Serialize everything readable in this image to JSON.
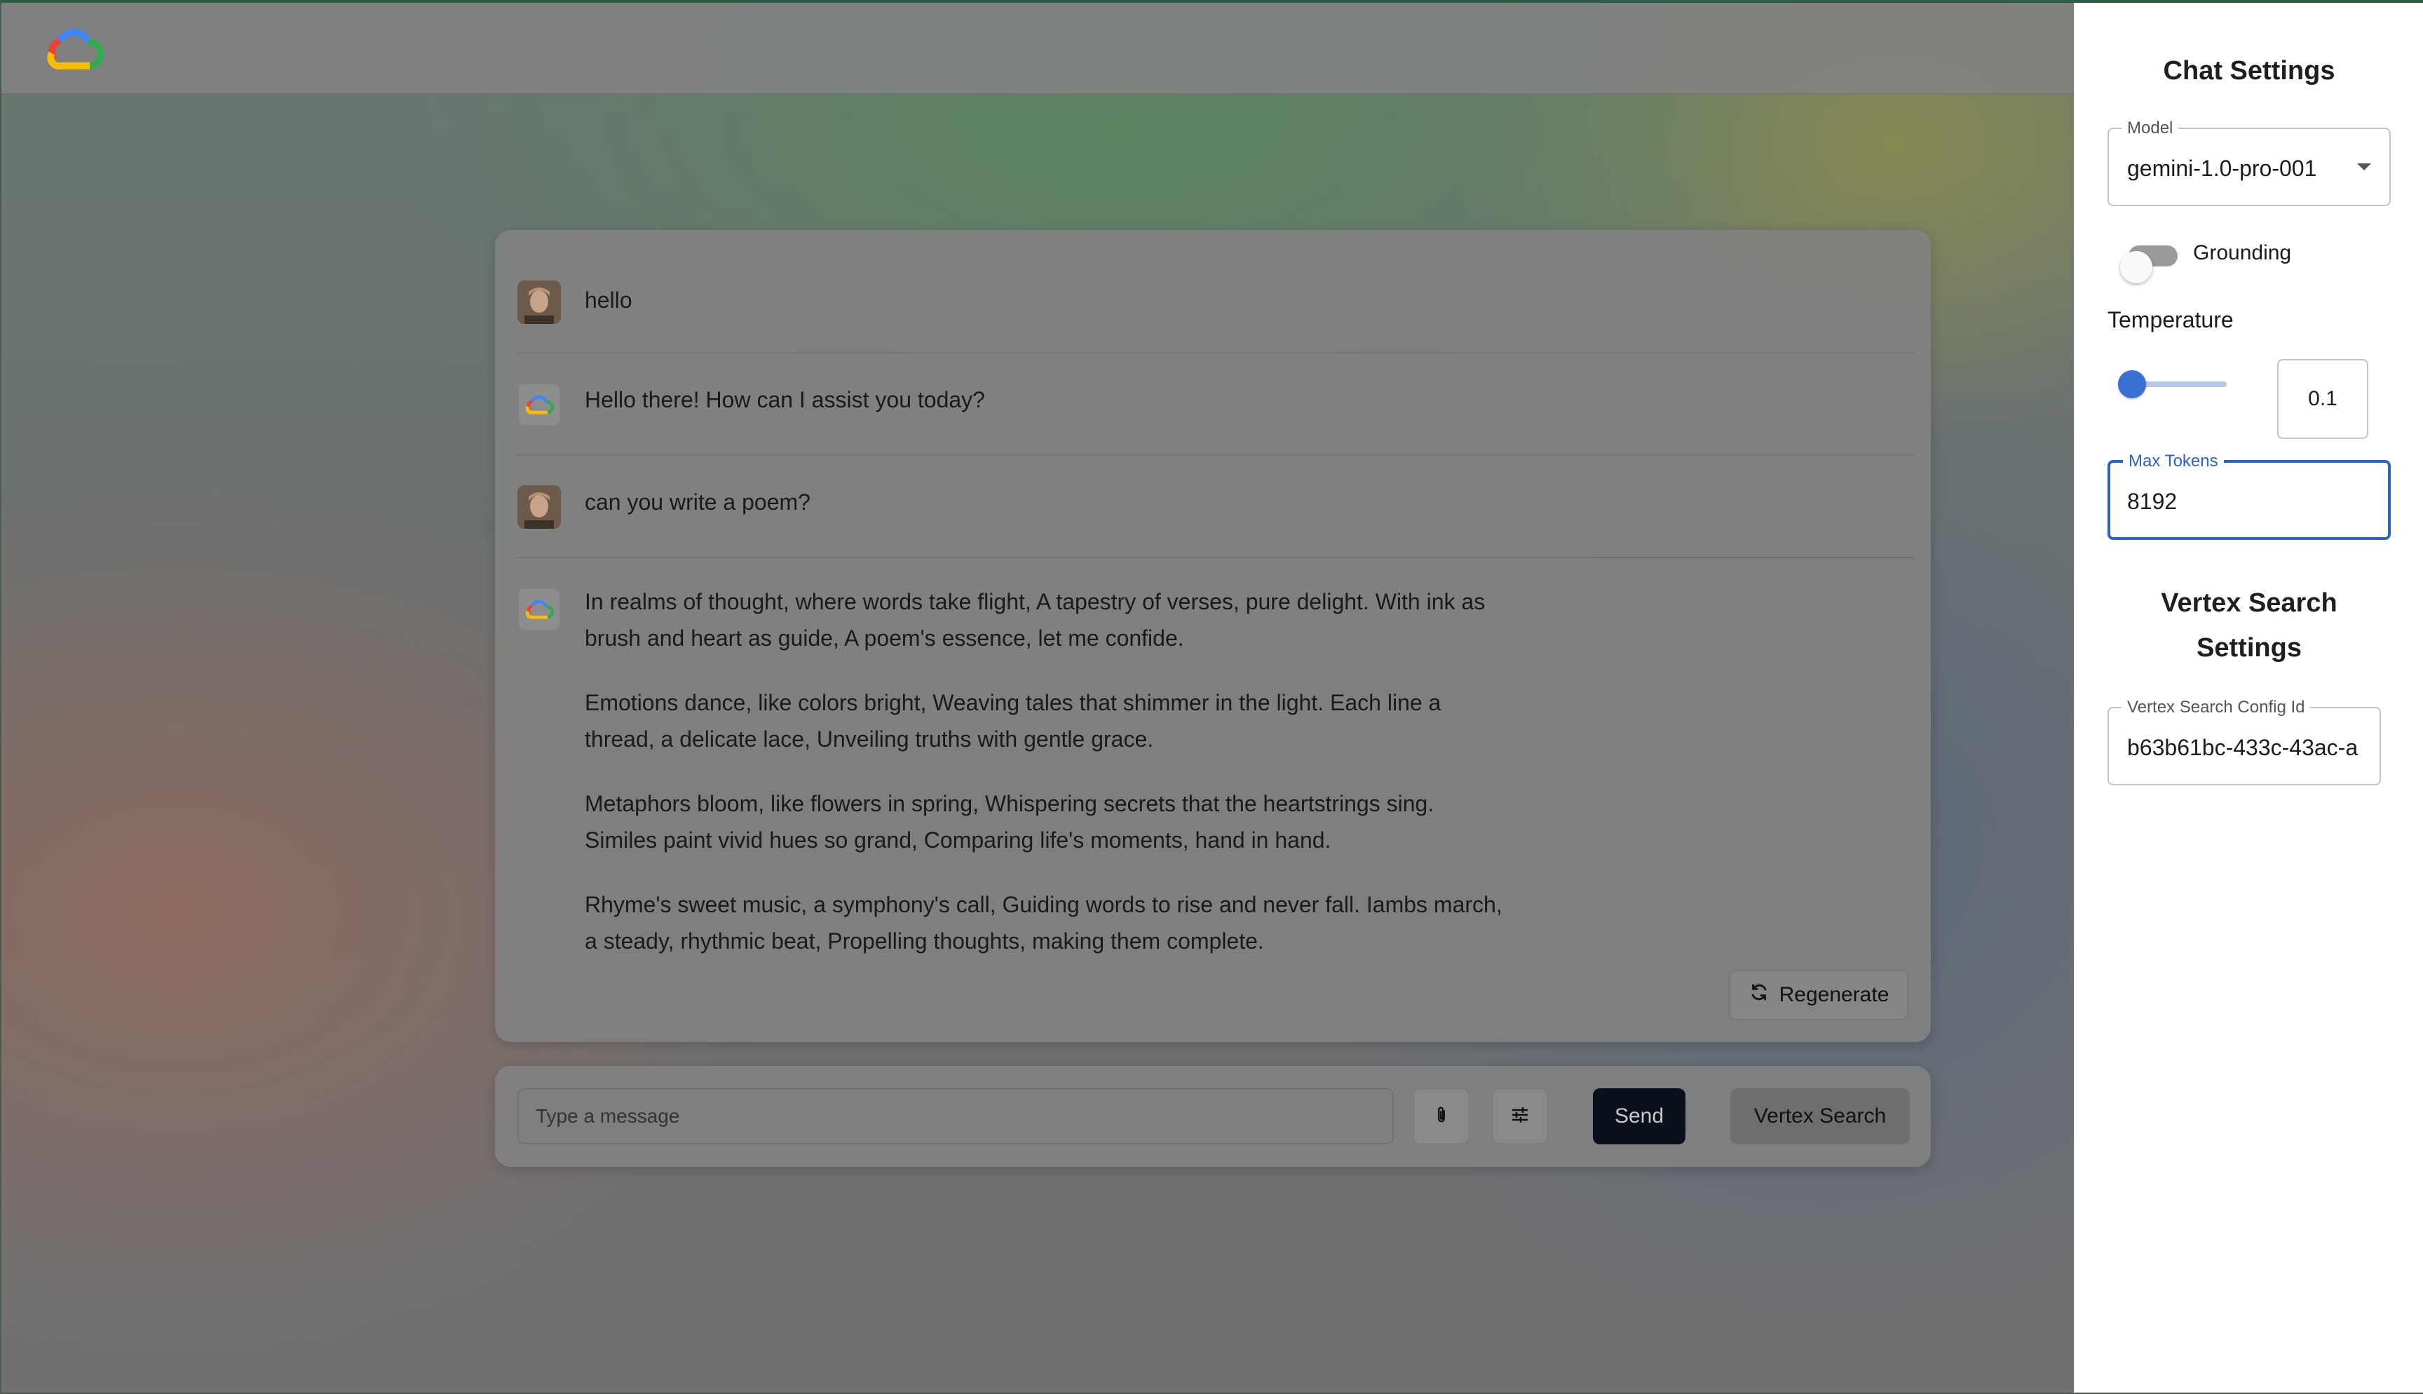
{
  "chat": {
    "messages": [
      {
        "role": "user",
        "text": "hello"
      },
      {
        "role": "assistant",
        "text": "Hello there! How can I assist you today?"
      },
      {
        "role": "user",
        "text": "can you write a poem?"
      },
      {
        "role": "assistant",
        "paragraphs": [
          "In realms of thought, where words take flight, A tapestry of verses, pure delight. With ink as brush and heart as guide, A poem's essence, let me confide.",
          "Emotions dance, like colors bright, Weaving tales that shimmer in the light. Each line a thread, a delicate lace, Unveiling truths with gentle grace.",
          "Metaphors bloom, like flowers in spring, Whispering secrets that the heartstrings sing. Similes paint vivid hues so grand, Comparing life's moments, hand in hand.",
          "Rhyme's sweet music, a symphony's call, Guiding words to rise and never fall. Iambs march, a steady, rhythmic beat, Propelling thoughts, making them complete."
        ]
      }
    ],
    "regenerate_label": "Regenerate"
  },
  "input": {
    "placeholder": "Type a message",
    "send_label": "Send",
    "vertex_search_label": "Vertex Search",
    "attach_icon": "paperclip-icon",
    "settings_icon": "sliders-icon"
  },
  "settings": {
    "title": "Chat Settings",
    "model": {
      "label": "Model",
      "value": "gemini-1.0-pro-001"
    },
    "grounding": {
      "label": "Grounding",
      "enabled": false
    },
    "temperature": {
      "label": "Temperature",
      "value": "0.1",
      "fraction": 0.1
    },
    "max_tokens": {
      "label": "Max Tokens",
      "value": "8192"
    },
    "vertex_title": "Vertex Search Settings",
    "vertex_config": {
      "label": "Vertex Search Config Id",
      "value": "b63b61bc-433c-43ac-a"
    }
  },
  "colors": {
    "accent": "#2c63c7",
    "send_button": "#0b111a",
    "google_blue": "#4285F4",
    "google_red": "#EA4335",
    "google_yellow": "#FBBC05",
    "google_green": "#34A853"
  }
}
